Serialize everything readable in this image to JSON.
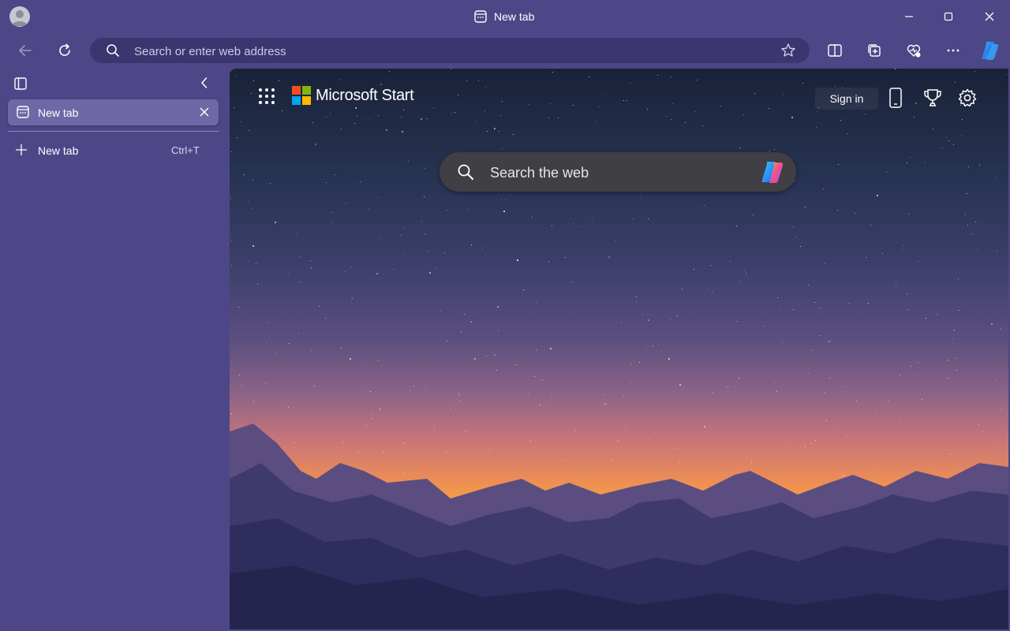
{
  "window": {
    "title": "New tab"
  },
  "toolbar": {
    "address_placeholder": "Search or enter web address"
  },
  "sidebar": {
    "active_tab_label": "New tab",
    "new_tab_label": "New tab",
    "new_tab_shortcut": "Ctrl+T"
  },
  "page": {
    "brand": "Microsoft Start",
    "sign_in_label": "Sign in",
    "search_placeholder": "Search the web"
  },
  "colors": {
    "chrome": "#4d4788",
    "address_bar": "#3b3570",
    "active_tab": "#6e68a6"
  },
  "icons": [
    "profile-avatar",
    "new-tab-icon",
    "minimize-icon",
    "maximize-icon",
    "close-icon",
    "back-arrow-icon",
    "refresh-icon",
    "search-icon",
    "favorite-star-icon",
    "split-screen-icon",
    "collections-icon",
    "browser-essentials-icon",
    "more-dots-icon",
    "copilot-icon",
    "sidebar-panel-icon",
    "collapse-chevron-icon",
    "plus-icon",
    "apps-grid-icon",
    "microsoft-logo",
    "phone-icon",
    "rewards-trophy-icon",
    "settings-gear-icon"
  ]
}
